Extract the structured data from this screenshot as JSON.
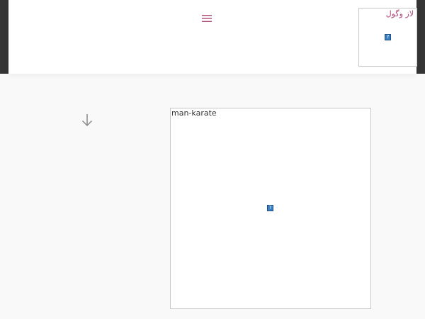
{
  "header": {
    "menu_icon": "hamburger-menu-icon",
    "logo_alt_text": "لاز وگول",
    "accent_color": "#b0487c"
  },
  "main": {
    "scroll_icon": "arrow-down-icon",
    "hero_image_alt_text": "man-karate"
  },
  "broken_image_icon": "?"
}
